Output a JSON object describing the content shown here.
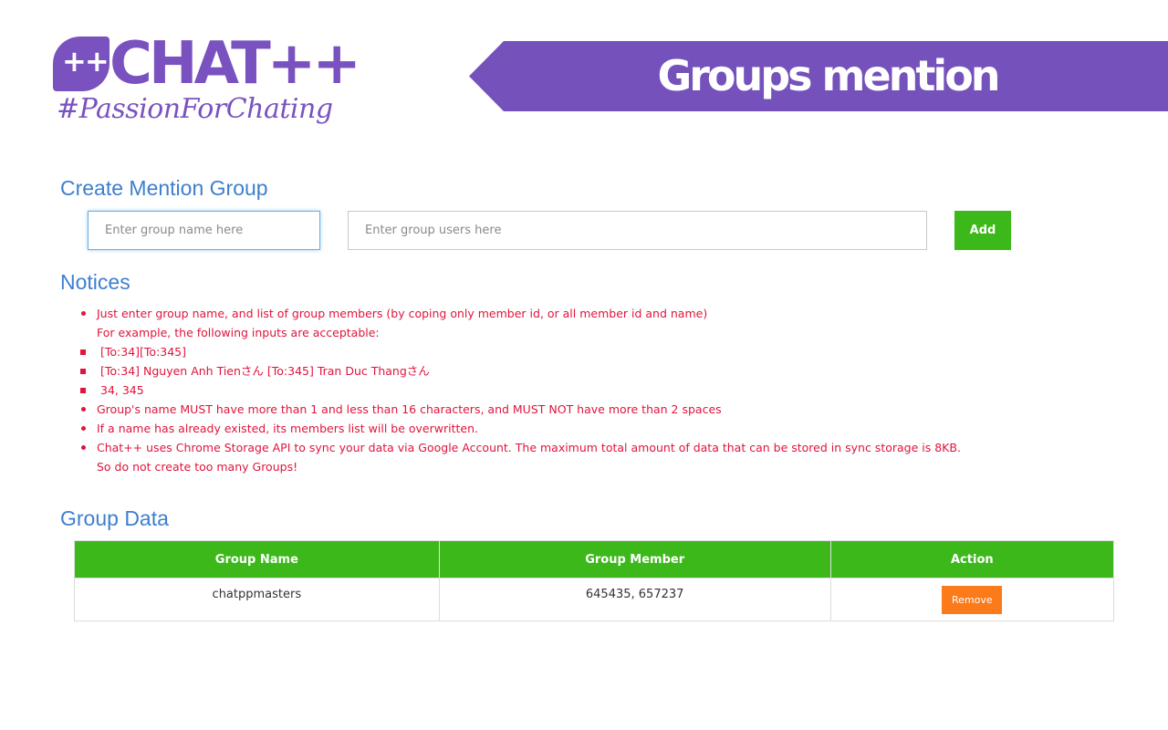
{
  "logo": {
    "badge": "++",
    "name": "CHAT++",
    "tagline": "#PassionForChating"
  },
  "header": {
    "title": "Groups mention"
  },
  "create": {
    "title": "Create Mention Group",
    "group_name_placeholder": "Enter group name here",
    "group_users_placeholder": "Enter group users here",
    "add_label": "Add"
  },
  "notices": {
    "title": "Notices",
    "items": [
      "Just enter group name, and list of group members (by coping only member id, or all member id and name)",
      "For example, the following inputs are acceptable:",
      "Group's name MUST have more than 1 and less than 16 characters, and MUST NOT have more than 2 spaces",
      "If a name has already existed, its members list will be overwritten.",
      "Chat++ uses Chrome Storage API to sync your data via Google Account. The maximum total amount of data that can be stored in sync storage is 8KB.",
      "So do not create too many Groups!"
    ],
    "examples": [
      "[To:34][To:345]",
      "[To:34] Nguyen Anh Tienさん [To:345] Tran Duc Thangさん",
      "34, 345"
    ]
  },
  "group_data": {
    "title": "Group Data",
    "columns": [
      "Group Name",
      "Group Member",
      "Action"
    ],
    "rows": [
      {
        "name": "chatppmasters",
        "members": "645435, 657237",
        "action": "Remove"
      }
    ]
  },
  "colors": {
    "brand_purple": "#7451bb",
    "heading_blue": "#3e7fcf",
    "notice_red": "#e0143c",
    "green": "#3cb81b",
    "orange": "#fb7a1a"
  }
}
